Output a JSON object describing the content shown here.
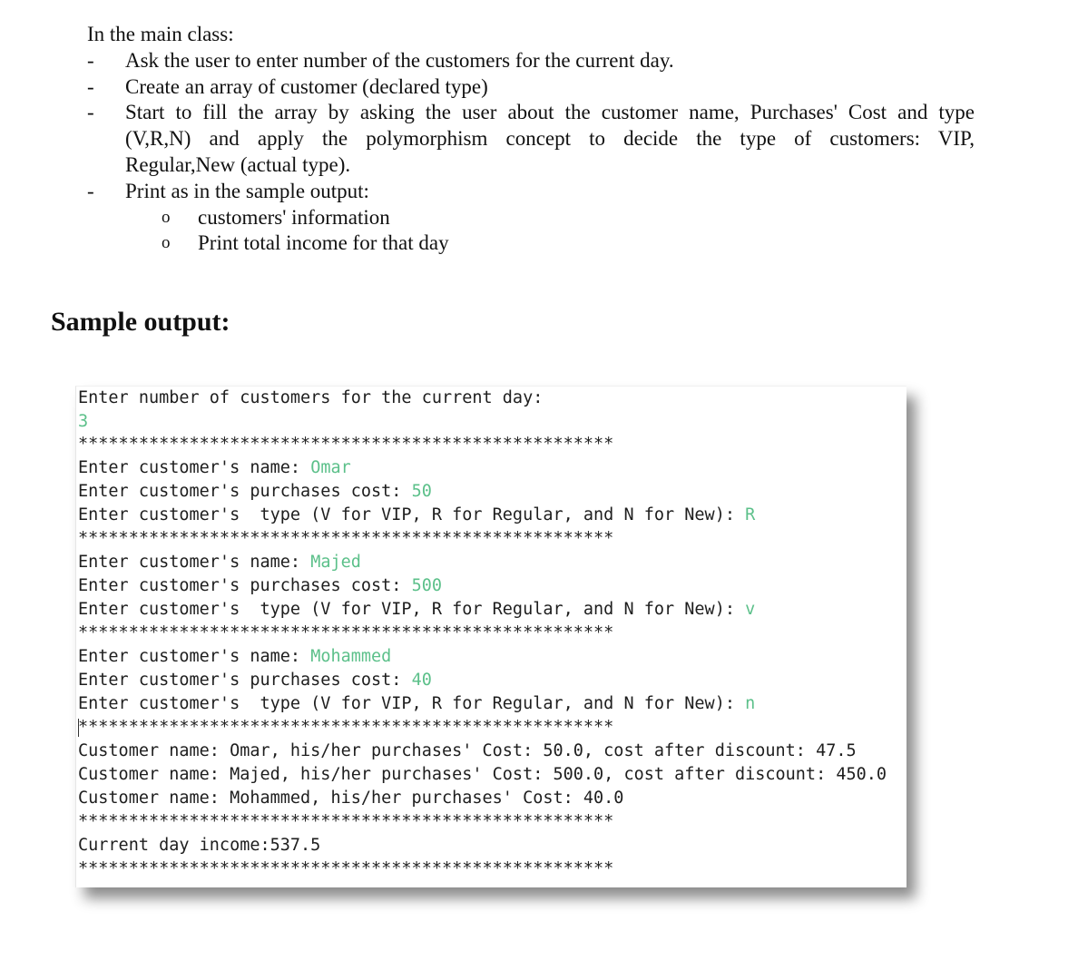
{
  "instructions": {
    "heading": "In the main class:",
    "items": [
      {
        "bullet": "-",
        "lines": [
          "Ask the user to enter number of the customers for the current day."
        ]
      },
      {
        "bullet": "-",
        "lines": [
          "Create an array of customer (declared type)"
        ]
      },
      {
        "bullet": "-",
        "lines": [
          "Start to fill the array by asking the user about the customer name, Purchases' Cost and type",
          "(V,R,N) and apply the polymorphism concept to decide the type of customers: VIP,",
          "Regular,New (actual type)."
        ]
      },
      {
        "bullet": "-",
        "lines": [
          "Print as in the sample output:"
        ],
        "subitems": [
          {
            "bullet": "o",
            "text": "customers' information"
          },
          {
            "bullet": "o",
            "text": "Print total income for that day"
          }
        ]
      }
    ]
  },
  "sample_title": "Sample output:",
  "console": {
    "separator": "*****************************************************",
    "prompt_count": "Enter number of customers for the current day:",
    "count_input": "3",
    "prompt_name": "Enter customer's name: ",
    "prompt_cost": "Enter customer's purchases cost: ",
    "prompt_type": "Enter customer's  type (V for VIP, R for Regular, and N for New): ",
    "entries": [
      {
        "name": "Omar",
        "cost": "50",
        "type": "R"
      },
      {
        "name": "Majed",
        "cost": "500",
        "type": "v"
      },
      {
        "name": "Mohammed",
        "cost": "40",
        "type": "n"
      }
    ],
    "results": [
      "Customer name: Omar, his/her purchases' Cost: 50.0, cost after discount: 47.5",
      "Customer name: Majed, his/her purchases' Cost: 500.0, cost after discount: 450.0",
      "Customer name: Mohammed, his/her purchases' Cost: 40.0"
    ],
    "income_line": "Current day income:537.5",
    "input_color": "#5cc08a"
  }
}
